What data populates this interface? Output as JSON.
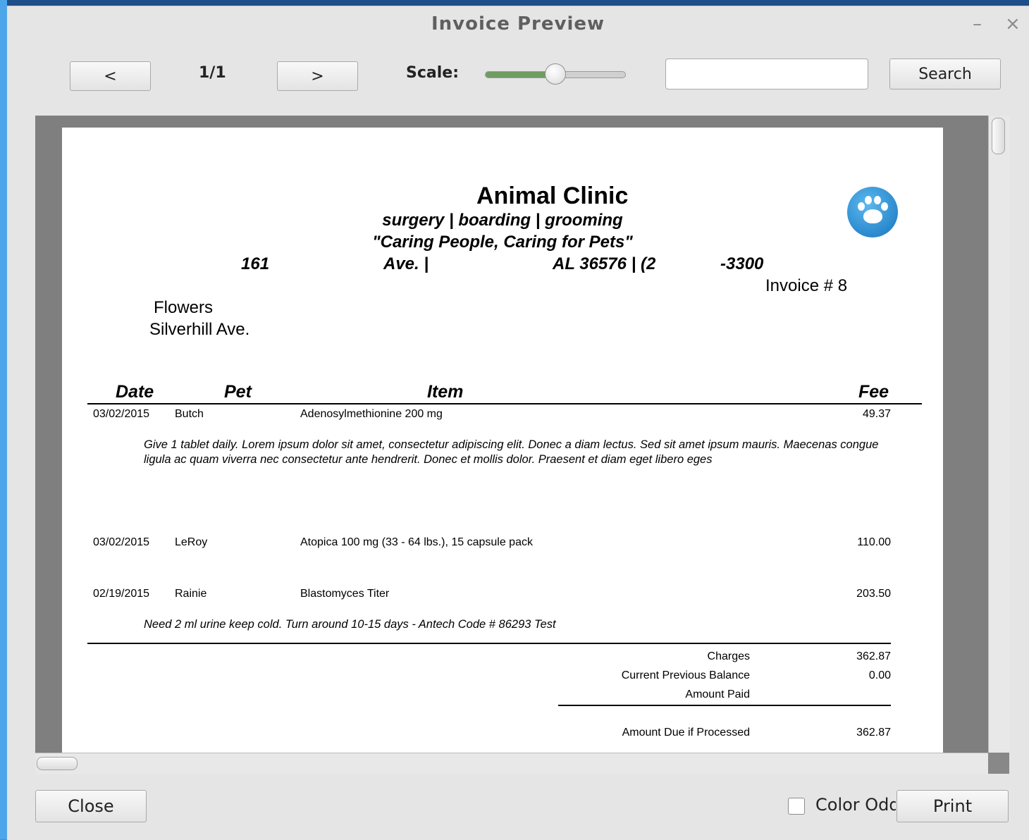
{
  "window": {
    "title": "Invoice Preview",
    "minimize_glyph": "–",
    "close_glyph": "×"
  },
  "toolbar": {
    "prev_label": "<",
    "page_indicator": "1/1",
    "next_label": ">",
    "scale_label": "Scale:",
    "scale_value": 0.5,
    "search_value": "",
    "search_label": "Search"
  },
  "invoice": {
    "clinic_name": "Animal Clinic",
    "services": "surgery | boarding | grooming",
    "slogan": "\"Caring People, Caring for Pets\"",
    "address_parts": [
      "161",
      "Ave. |",
      "AL  36576 | (2",
      "-3300"
    ],
    "logo_icon": "paw-icon",
    "invoice_number": "Invoice # 8",
    "client": {
      "name": "Flowers",
      "street": "Silverhill Ave."
    },
    "columns": {
      "date": "Date",
      "pet": "Pet",
      "item": "Item",
      "fee": "Fee"
    },
    "lines": [
      {
        "date": "03/02/2015",
        "pet": "Butch",
        "item": "Adenosylmethionine 200 mg",
        "fee": "49.37",
        "note": "Give 1 tablet daily.  Lorem ipsum dolor sit amet, consectetur adipiscing elit. Donec a diam lectus. Sed sit amet ipsum mauris. Maecenas congue ligula ac quam viverra nec consectetur ante hendrerit. Donec et mollis dolor. Praesent et diam eget libero eges"
      },
      {
        "date": "03/02/2015",
        "pet": "LeRoy",
        "item": "Atopica 100 mg (33 - 64 lbs.), 15 capsule pack",
        "fee": "110.00",
        "note": ""
      },
      {
        "date": "02/19/2015",
        "pet": "Rainie",
        "item": "Blastomyces Titer",
        "fee": "203.50",
        "note": "Need 2 ml urine keep cold. Turn around 10-15 days - Antech Code #  86293 Test"
      }
    ],
    "totals": {
      "charges_label": "Charges",
      "charges": "362.87",
      "prev_balance_label": "Current Previous Balance",
      "prev_balance": "0.00",
      "paid_label": "Amount Paid",
      "paid": "",
      "due_label": "Amount Due if Processed",
      "due": "362.87"
    }
  },
  "footer": {
    "close_label": "Close",
    "color_odd_label": "Color Odd",
    "color_odd_checked": false,
    "print_label": "Print"
  }
}
